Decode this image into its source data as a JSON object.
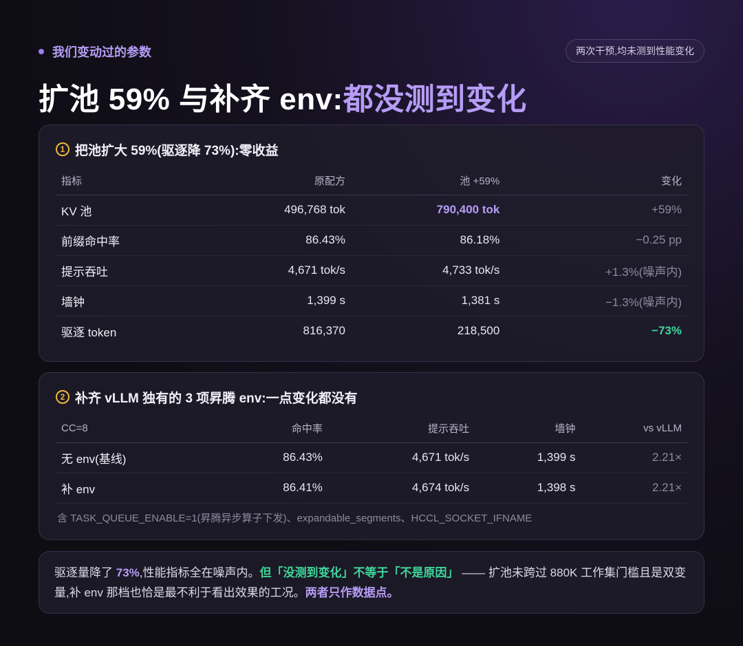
{
  "eyebrow": "我们变动过的参数",
  "pill": "两次干预,均未测到性能变化",
  "headline": {
    "main": "扩池 59% 与补齐 env:",
    "accent": "都没测到变化"
  },
  "card1": {
    "number": "1",
    "title": "把池扩大 59%(驱逐降 73%):零收益",
    "headers": [
      "指标",
      "原配方",
      "池 +59%",
      "变化"
    ],
    "rows": [
      [
        "KV 池",
        "496,768 tok",
        "790,400 tok",
        "+59%"
      ],
      [
        "前缀命中率",
        "86.43%",
        "86.18%",
        "−0.25 pp"
      ],
      [
        "提示吞吐",
        "4,671 tok/s",
        "4,733 tok/s",
        "+1.3%(噪声内)"
      ],
      [
        "墙钟",
        "1,399 s",
        "1,381 s",
        "−1.3%(噪声内)"
      ],
      [
        "驱逐 token",
        "816,370",
        "218,500",
        "−73%"
      ]
    ]
  },
  "card2": {
    "number": "2",
    "title": "补齐 vLLM 独有的 3 项昇腾 env:一点变化都没有",
    "headers": [
      "CC=8",
      "命中率",
      "提示吞吐",
      "墙钟",
      "vs vLLM"
    ],
    "rows": [
      [
        "无 env(基线)",
        "86.43%",
        "4,671 tok/s",
        "1,399 s",
        "2.21×"
      ],
      [
        "补 env",
        "86.41%",
        "4,674 tok/s",
        "1,398 s",
        "2.21×"
      ]
    ],
    "footnote": "含 TASK_QUEUE_ENABLE=1(昇腾异步算子下发)、expandable_segments、HCCL_SOCKET_IFNAME"
  },
  "note": {
    "s1": "驱逐量降了 ",
    "s2": "73%",
    "s3": ",性能指标全在噪声内。",
    "s4": "但「没测到变化」不等于「不是原因」",
    "s5": " —— 扩池未跨过 880K 工作集门槛且是双变量,补 env 那档也恰是最不利于看出效果的工况。",
    "s6": "两者只作数据点。"
  },
  "colors": {
    "accent": "#b69cf5",
    "green": "#3fd69a",
    "badge": "#f0b93a"
  }
}
